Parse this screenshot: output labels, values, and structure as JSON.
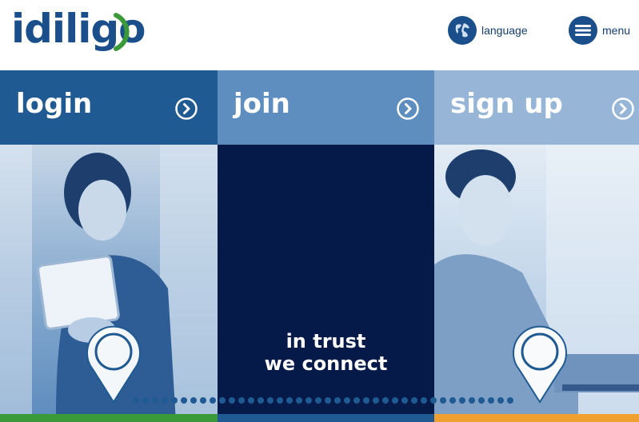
{
  "brand": {
    "name": "idiligo",
    "arc_color": "#3a9a3a"
  },
  "header": {
    "language_label": "language",
    "menu_label": "menu",
    "language_icon": "globe-icon",
    "menu_icon": "hamburger-icon"
  },
  "panels": [
    {
      "title": "login",
      "icon": "chevron-circle-right-icon",
      "bar_color": "#3a9a3a"
    },
    {
      "title": "join",
      "icon": "chevron-circle-right-icon",
      "bar_color": "#1f5a93"
    },
    {
      "title": "sign up",
      "icon": "chevron-circle-right-icon",
      "bar_color": "#f0a030"
    }
  ],
  "tagline": {
    "line1": "in trust",
    "line2": "we connect"
  },
  "colors": {
    "primary": "#1a4f8c",
    "navy": "#061a4a",
    "mid_blue": "#5d8ebf",
    "light_blue": "#97b6d7"
  }
}
